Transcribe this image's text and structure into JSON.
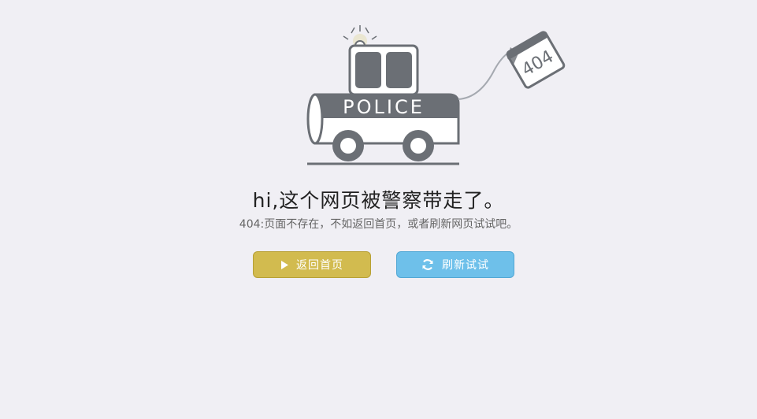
{
  "illustration": {
    "badge_text": "POLICE",
    "tag_text": "404"
  },
  "message": {
    "title": "hi,这个网页被警察带走了。",
    "subtitle": "404:页面不存在，不如返回首页，或者刷新网页试试吧。"
  },
  "actions": {
    "home_label": "返回首页",
    "refresh_label": "刷新试试",
    "home_color": "#d2bb4f",
    "refresh_color": "#6ec0ea"
  }
}
